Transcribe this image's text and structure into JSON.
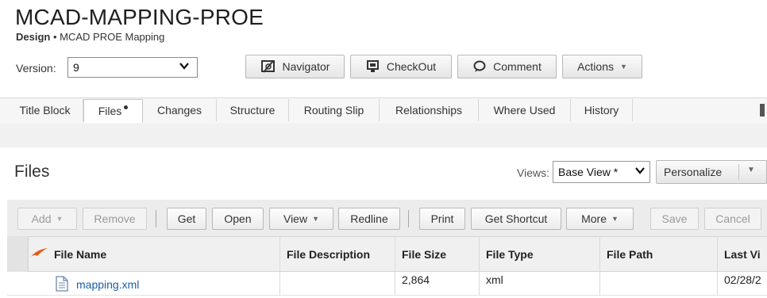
{
  "header": {
    "title": "MCAD-MAPPING-PROE",
    "subtitle_bold": "Design",
    "subtitle_sep": "•",
    "subtitle_rest": "MCAD PROE Mapping"
  },
  "version": {
    "label": "Version:",
    "value": "9"
  },
  "header_buttons": {
    "navigator": "Navigator",
    "checkout": "CheckOut",
    "comment": "Comment",
    "actions": "Actions"
  },
  "tabs": [
    {
      "label": "Title Block"
    },
    {
      "label": "Files",
      "active": true
    },
    {
      "label": "Changes"
    },
    {
      "label": "Structure"
    },
    {
      "label": "Routing Slip"
    },
    {
      "label": "Relationships"
    },
    {
      "label": "Where Used"
    },
    {
      "label": "History"
    }
  ],
  "files_section": {
    "title": "Files",
    "views_label": "Views:",
    "views_value": "Base View *",
    "personalize": "Personalize"
  },
  "toolbar": {
    "add": "Add",
    "remove": "Remove",
    "get": "Get",
    "open": "Open",
    "view": "View",
    "redline": "Redline",
    "print": "Print",
    "get_shortcut": "Get Shortcut",
    "more": "More",
    "save": "Save",
    "cancel": "Cancel"
  },
  "table": {
    "columns": [
      "File Name",
      "File Description",
      "File Size",
      "File Type",
      "File Path",
      "Last Vi"
    ],
    "rows": [
      {
        "file_name": "mapping.xml",
        "file_description": "",
        "file_size": "2,864",
        "file_type": "xml",
        "file_path": "",
        "last_vi": "02/28/2"
      }
    ]
  },
  "colors": {
    "link": "#1c5ea8",
    "flag": "#e35b12"
  }
}
